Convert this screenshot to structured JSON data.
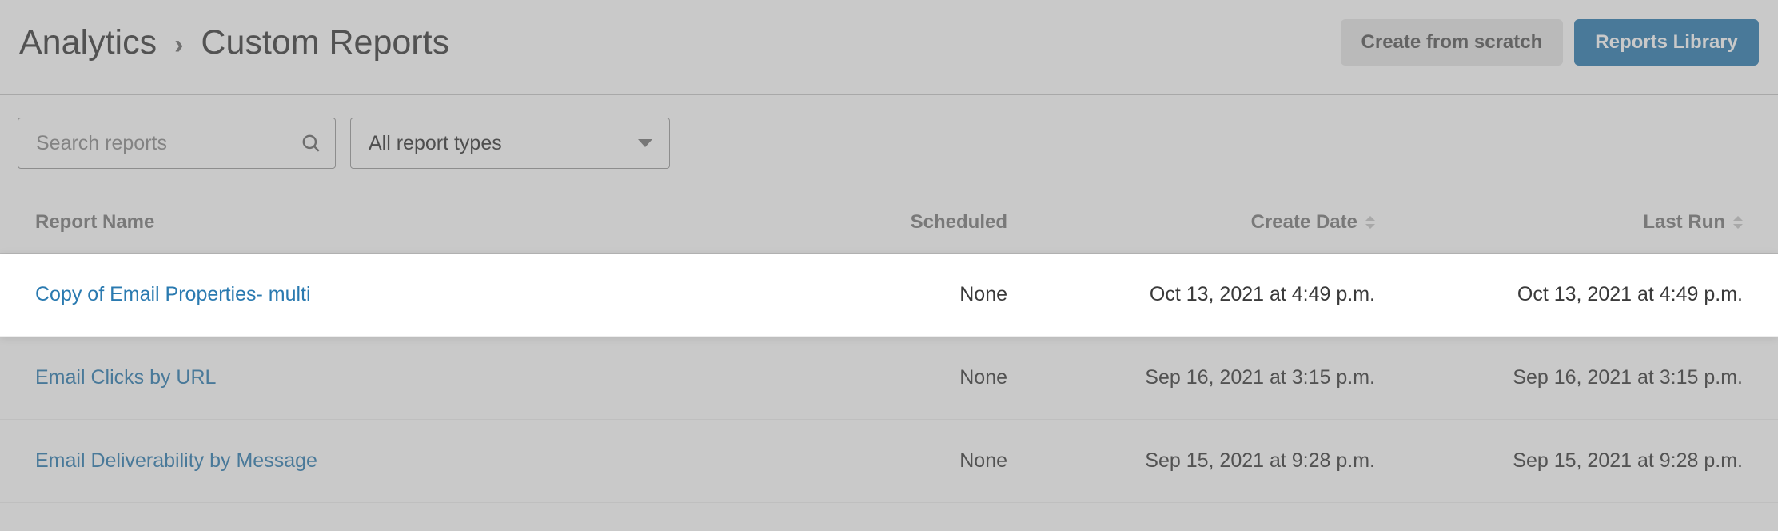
{
  "header": {
    "breadcrumb_root": "Analytics",
    "breadcrumb_sep": "›",
    "breadcrumb_current": "Custom Reports",
    "create_label": "Create from scratch",
    "library_label": "Reports Library"
  },
  "filters": {
    "search_placeholder": "Search reports",
    "type_filter_label": "All report types"
  },
  "columns": {
    "name": "Report Name",
    "scheduled": "Scheduled",
    "create_date": "Create Date",
    "last_run": "Last Run"
  },
  "rows": [
    {
      "name": "Copy of Email Properties- multi",
      "scheduled": "None",
      "create_date": "Oct 13, 2021 at 4:49 p.m.",
      "last_run": "Oct 13, 2021 at 4:49 p.m.",
      "highlight": true
    },
    {
      "name": "Email Clicks by URL",
      "scheduled": "None",
      "create_date": "Sep 16, 2021 at 3:15 p.m.",
      "last_run": "Sep 16, 2021 at 3:15 p.m.",
      "highlight": false
    },
    {
      "name": "Email Deliverability by Message",
      "scheduled": "None",
      "create_date": "Sep 15, 2021 at 9:28 p.m.",
      "last_run": "Sep 15, 2021 at 9:28 p.m.",
      "highlight": false
    }
  ]
}
